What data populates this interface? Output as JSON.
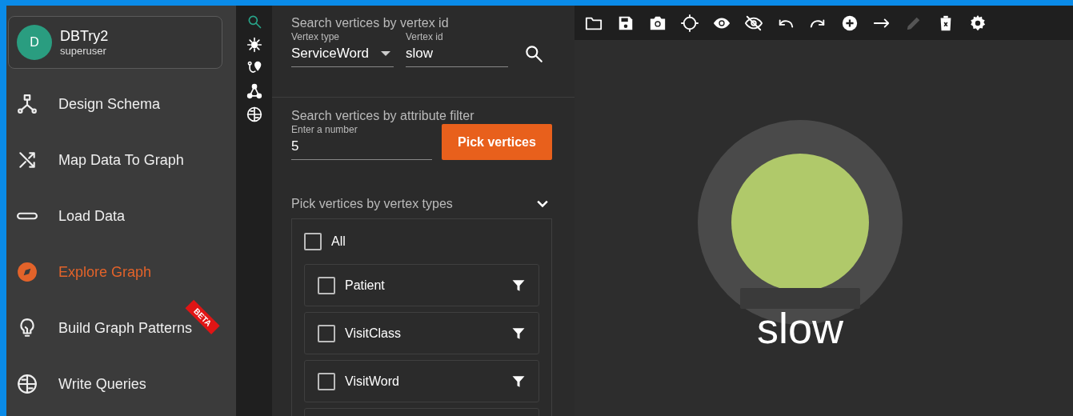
{
  "user": {
    "avatar_letter": "D",
    "name": "DBTry2",
    "role": "superuser"
  },
  "sidebar": {
    "items": [
      {
        "kind": "schema",
        "label": "Design Schema",
        "selected": false
      },
      {
        "kind": "map",
        "label": "Map Data To Graph",
        "selected": false
      },
      {
        "kind": "load",
        "label": "Load Data",
        "selected": false
      },
      {
        "kind": "explore",
        "label": "Explore Graph",
        "selected": true
      },
      {
        "kind": "patterns",
        "label": "Build Graph Patterns",
        "selected": false,
        "badge": "BETA"
      },
      {
        "kind": "queries",
        "label": "Write Queries",
        "selected": false
      }
    ]
  },
  "tool_strip": [
    {
      "kind": "search",
      "selected": true
    },
    {
      "kind": "expand",
      "selected": false
    },
    {
      "kind": "path",
      "selected": false
    },
    {
      "kind": "graph",
      "selected": false
    },
    {
      "kind": "globe",
      "selected": false
    }
  ],
  "search_by_id": {
    "title": "Search vertices by vertex id",
    "vertex_type": {
      "label": "Vertex type",
      "value": "ServiceWord"
    },
    "vertex_id": {
      "label": "Vertex id",
      "value": "slow"
    }
  },
  "attribute_filter": {
    "title": "Search vertices by attribute filter",
    "number": {
      "label": "Enter a number",
      "value": "5"
    },
    "button": "Pick vertices"
  },
  "vertex_types": {
    "title": "Pick vertices by vertex types",
    "expanded": true,
    "all": {
      "label": "All",
      "checked": false
    },
    "items": [
      {
        "label": "Patient",
        "checked": false
      },
      {
        "label": "VisitClass",
        "checked": false
      },
      {
        "label": "VisitWord",
        "checked": false
      }
    ]
  },
  "toolbar": [
    {
      "kind": "folder",
      "disabled": false
    },
    {
      "kind": "save",
      "disabled": false
    },
    {
      "kind": "camera",
      "disabled": false
    },
    {
      "kind": "crosshair",
      "disabled": false
    },
    {
      "kind": "eye",
      "disabled": false
    },
    {
      "kind": "eye-off",
      "disabled": false
    },
    {
      "kind": "undo",
      "disabled": false
    },
    {
      "kind": "redo",
      "disabled": false
    },
    {
      "kind": "plus",
      "disabled": false
    },
    {
      "kind": "arrow",
      "disabled": false
    },
    {
      "kind": "pencil",
      "disabled": true
    },
    {
      "kind": "trash",
      "disabled": false
    },
    {
      "kind": "gear",
      "disabled": false
    }
  ],
  "graph": {
    "nodes": [
      {
        "label": "slow",
        "color": "#b0c96a",
        "selected": true
      }
    ]
  }
}
